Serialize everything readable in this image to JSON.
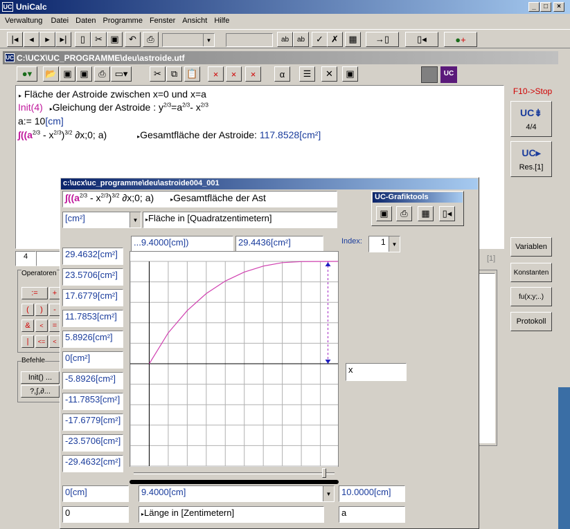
{
  "app": {
    "title": "UniCalc",
    "logo": "UC"
  },
  "menu": [
    "Verwaltung",
    "Datei",
    "Daten",
    "Programme",
    "Fenster",
    "Ansicht",
    "Hilfe"
  ],
  "doc": {
    "title": "C:\\UCX\\UC_PROGRAMME\\deu\\astroide.utf",
    "lines": {
      "l1": "Fläche der  Astroide  zwischen x=0 und x=a",
      "l2_init": "Init(4)",
      "l2_comment": "Gleichung der Astroide  : y",
      "l2_eq": "=a",
      "l2_minus": "- x",
      "l3_a": "a:= 10",
      "l3_unit": "[cm]",
      "l4_int": "∫((a",
      "l4_mid": " - x",
      "l4_close": ")",
      "l4_rest": " ∂x;0; a)",
      "l4_comment": "Gesamtfläche der Astroide:",
      "l4_result": "117.8528",
      "l4_unit": "[cm²]"
    },
    "exp_two_thirds": "2/3",
    "exp_three_halves": "3/2"
  },
  "side": {
    "stop": "F10->Stop",
    "counter": "4/4",
    "res": "Res.[1]",
    "buttons": [
      "Variablen",
      "Konstanten",
      "fu(x;y;..)",
      "Protokoll"
    ]
  },
  "behind": {
    "counter_field": "4",
    "bracket": "[1]",
    "operators_label": "Operatoren",
    "op_rows": [
      [
        ":=",
        "+"
      ],
      [
        "(",
        ")",
        "-"
      ],
      [
        "&",
        "<",
        "="
      ],
      [
        "|",
        "<=",
        "<"
      ]
    ],
    "befehle_label": "Befehle",
    "befehle": [
      "Init() ...",
      "?,∫,∂..."
    ]
  },
  "graph": {
    "title": "c:\\ucx\\uc_programme\\deu\\astroide004_001",
    "expr_int": "∫((a",
    "expr_mid": " - x",
    "expr_close": ")",
    "expr_rest": " ∂x;0; a)",
    "expr_comment": "Gesamtfläche der Ast",
    "unit_select": "[cm²]",
    "unit_desc": "Fläche in [Quadratzentimetern]",
    "cursor_x": "...9.4000[cm])",
    "cursor_y": "29.4436[cm²]",
    "index_label": "Index:",
    "index_value": "1",
    "x_field": "x",
    "x_min": "0[cm]",
    "x_cursor": "9.4000[cm]",
    "x_max": "10.0000[cm]",
    "x_min2": "0",
    "x_desc": "Länge in [Zentimetern]",
    "x_var": "a",
    "y_labels": [
      "29.4632[cm²]",
      "23.5706[cm²]",
      "17.6779[cm²]",
      "11.7853[cm²]",
      "5.8926[cm²]",
      "0[cm²]",
      "-5.8926[cm²]",
      "-11.7853[cm²]",
      "-17.6779[cm²]",
      "-23.5706[cm²]",
      "-29.4632[cm²]"
    ]
  },
  "tools": {
    "title": "UC-Grafiktools"
  },
  "chart_data": {
    "type": "line",
    "x": [
      0,
      1,
      2,
      3,
      4,
      5,
      6,
      7,
      8,
      9,
      10
    ],
    "y": [
      0,
      8.9,
      15.3,
      20.2,
      23.8,
      26.4,
      28.1,
      29.1,
      29.4,
      29.45,
      29.46
    ],
    "xlim": [
      -1.0,
      10.0
    ],
    "ylim": [
      -29.4632,
      29.4632
    ],
    "cursor": {
      "x": 9.4,
      "y": 29.4436
    },
    "grid": true,
    "line_color": "#d040b0"
  }
}
